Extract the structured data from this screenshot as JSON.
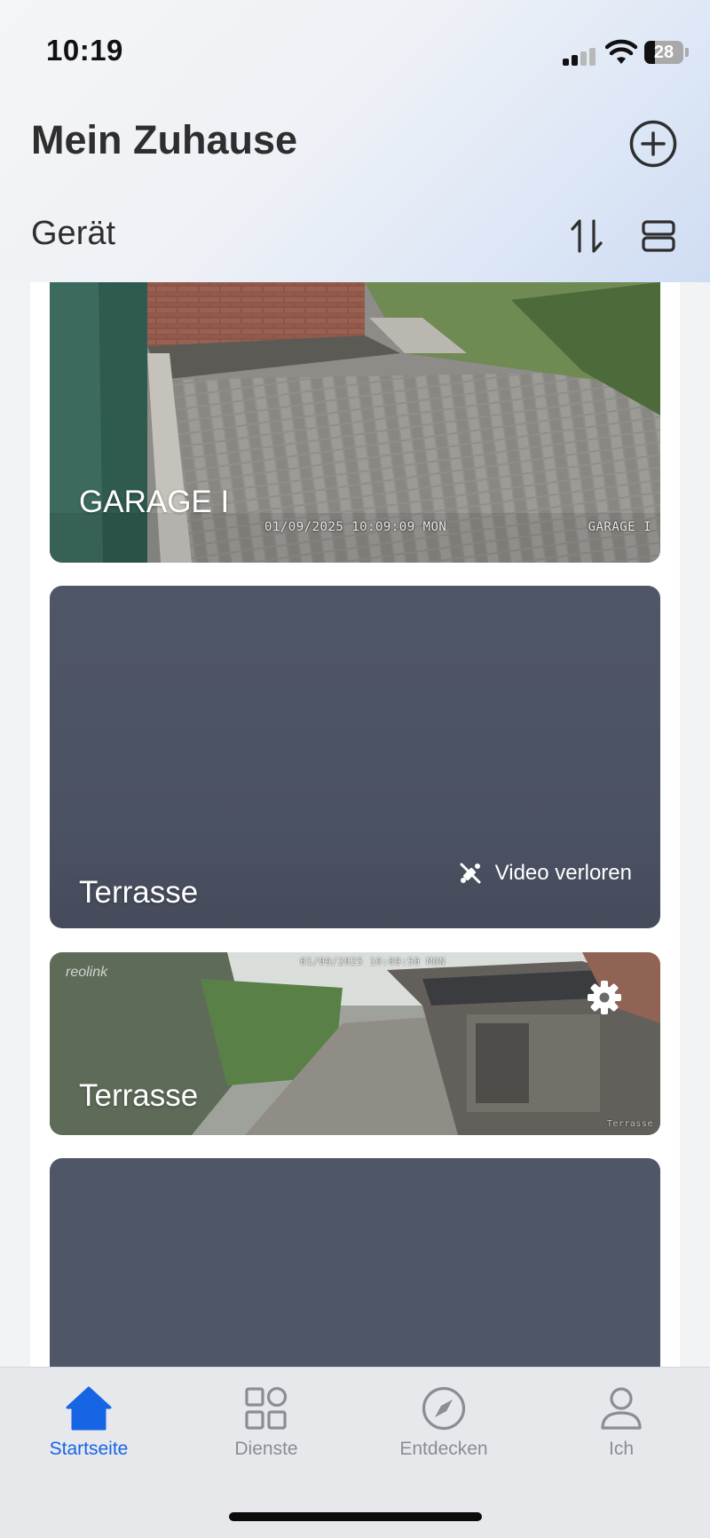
{
  "status_bar": {
    "time": "10:19",
    "battery": "28",
    "battery_level": 0.28
  },
  "header": {
    "title": "Mein Zuhause"
  },
  "section": {
    "title": "Gerät"
  },
  "cameras": [
    {
      "name": "GARAGE I",
      "osd_time": "01/09/2025 10:09:09 MON",
      "osd_name": "GARAGE I"
    },
    {
      "name": "Terrasse",
      "status": "Video verloren"
    },
    {
      "name": "Terrasse",
      "brand": "reolink",
      "osd_time": "01/09/2025 10:09:50 MON",
      "osd_name": "Terrasse"
    },
    {
      "name": ""
    }
  ],
  "tabs": [
    {
      "label": "Startseite",
      "icon": "home-icon",
      "active": true
    },
    {
      "label": "Dienste",
      "icon": "grid-icon",
      "active": false
    },
    {
      "label": "Entdecken",
      "icon": "compass-icon",
      "active": false
    },
    {
      "label": "Ich",
      "icon": "person-icon",
      "active": false
    }
  ],
  "colors": {
    "accent": "#1665e4",
    "card_offline": "#4f5666",
    "tab_inactive": "#8c8d92"
  }
}
